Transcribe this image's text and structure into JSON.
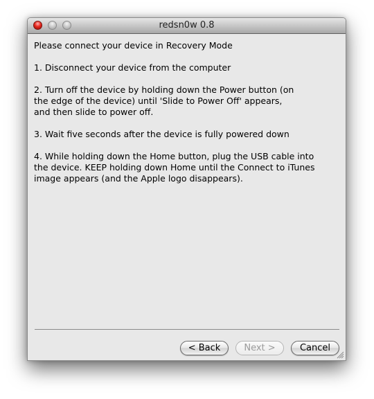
{
  "window": {
    "title": "redsn0w 0.8",
    "controls": [
      "close",
      "minimize",
      "zoom"
    ]
  },
  "content": {
    "heading": "Please connect your device in Recovery Mode",
    "steps": [
      "1. Disconnect your device from the computer",
      "2. Turn off the device by holding down the Power button (on\nthe edge of the device) until 'Slide to Power Off' appears,\nand then slide to power off.",
      "3. Wait five seconds after the device is fully powered down",
      "4. While holding down the Home button, plug the USB cable into\nthe device. KEEP holding down Home until the Connect to iTunes\nimage appears (and the Apple logo disappears)."
    ]
  },
  "buttons": {
    "back": "< Back",
    "next": "Next >",
    "cancel": "Cancel",
    "next_enabled": false
  }
}
